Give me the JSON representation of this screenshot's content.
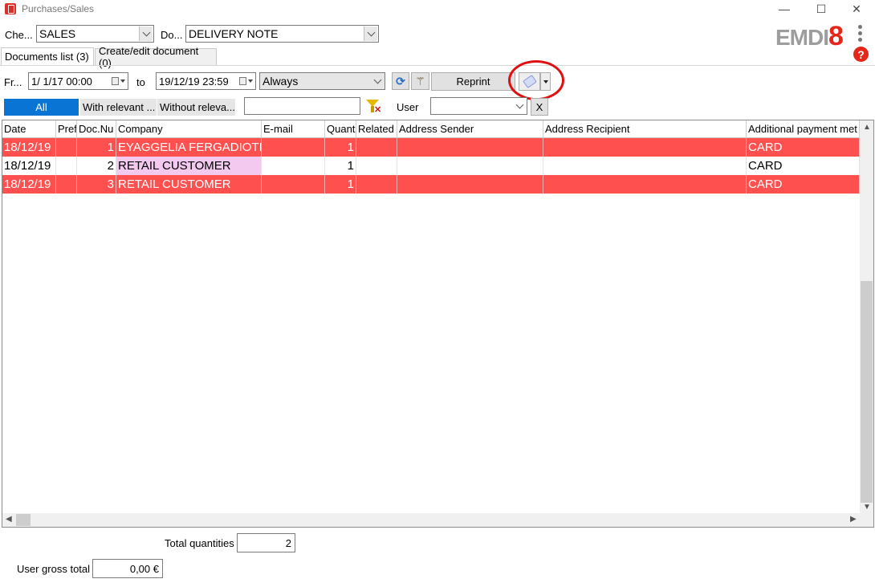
{
  "window": {
    "title": "Purchases/Sales",
    "minimize": "—",
    "maximize": "☐",
    "close": "✕"
  },
  "toolbar": {
    "check_label": "Che...",
    "check_value": "SALES",
    "doc_label": "Do...",
    "doc_value": "DELIVERY NOTE"
  },
  "logo": {
    "text_gray": "EMDI",
    "text_red": "8"
  },
  "help_label": "?",
  "tabs": [
    {
      "label": "Documents list (3)",
      "active": true
    },
    {
      "label": "Create/edit document (0)",
      "active": false
    }
  ],
  "date_filter": {
    "from_label": "Fr...",
    "from_value": "1/  1/17 00:00",
    "to_label": "to",
    "to_value": "19/12/19 23:59",
    "period_value": "Always",
    "reprint_label": "Reprint"
  },
  "filters": {
    "all": "All",
    "with_relevant": "With relevant ...",
    "without_relevant": "Without releva...",
    "search_value": "",
    "user_label": "User",
    "user_value": "",
    "clear_label": "X"
  },
  "table": {
    "columns": [
      "Date",
      "Pref",
      "Doc.Nu",
      "Company",
      "E-mail",
      "Quant",
      "Related",
      "Address Sender",
      "Address Recipient",
      "Additional payment met"
    ],
    "rows": [
      {
        "date": "18/12/19",
        "pref": "",
        "docnum": "1",
        "company": "EYAGGELIA FERGADIOTI",
        "email": "",
        "quant": "1",
        "related": "",
        "sender": "",
        "recipient": "",
        "payment": "CARD",
        "highlight": "red"
      },
      {
        "date": "18/12/19",
        "pref": "",
        "docnum": "2",
        "company": "RETAIL CUSTOMER",
        "email": "",
        "quant": "1",
        "related": "",
        "sender": "",
        "recipient": "",
        "payment": "CARD",
        "highlight": "none"
      },
      {
        "date": "18/12/19",
        "pref": "",
        "docnum": "3",
        "company": "RETAIL CUSTOMER",
        "email": "",
        "quant": "1",
        "related": "",
        "sender": "",
        "recipient": "",
        "payment": "CARD",
        "highlight": "red"
      }
    ]
  },
  "totals": {
    "quantities_label": "Total quantities",
    "quantities_value": "2",
    "gross_label": "User gross total",
    "gross_value": "0,00 €"
  },
  "colors": {
    "row_red": "#ff5050",
    "selected_blue": "#0a74d4",
    "company_highlight": "#f3c9f0",
    "annotation": "#e01010"
  }
}
